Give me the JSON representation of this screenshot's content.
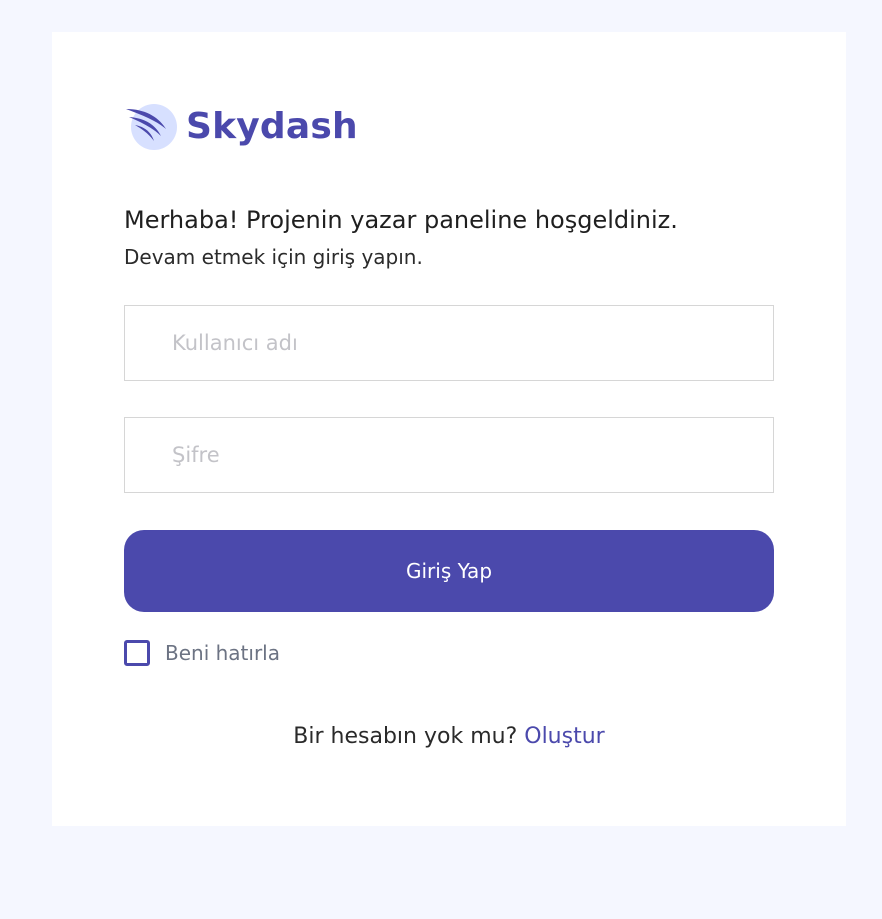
{
  "brand": {
    "name": "Skydash",
    "logo_icon": "wing-logo-icon"
  },
  "login": {
    "welcome": "Merhaba! Projenin yazar paneline hoşgeldiniz.",
    "subtitle": "Devam etmek için giriş yapın.",
    "username": {
      "placeholder": "Kullanıcı adı",
      "value": ""
    },
    "password": {
      "placeholder": "Şifre",
      "value": ""
    },
    "submit_label": "Giriş Yap",
    "remember_label": "Beni hatırla",
    "remember_checked": false,
    "signup_prompt": "Bir hesabın yok mu?",
    "signup_link": "Oluştur"
  },
  "colors": {
    "accent": "#4b49ac",
    "page_background": "#f5f7ff",
    "logo_circle": "#d7e0ff"
  }
}
